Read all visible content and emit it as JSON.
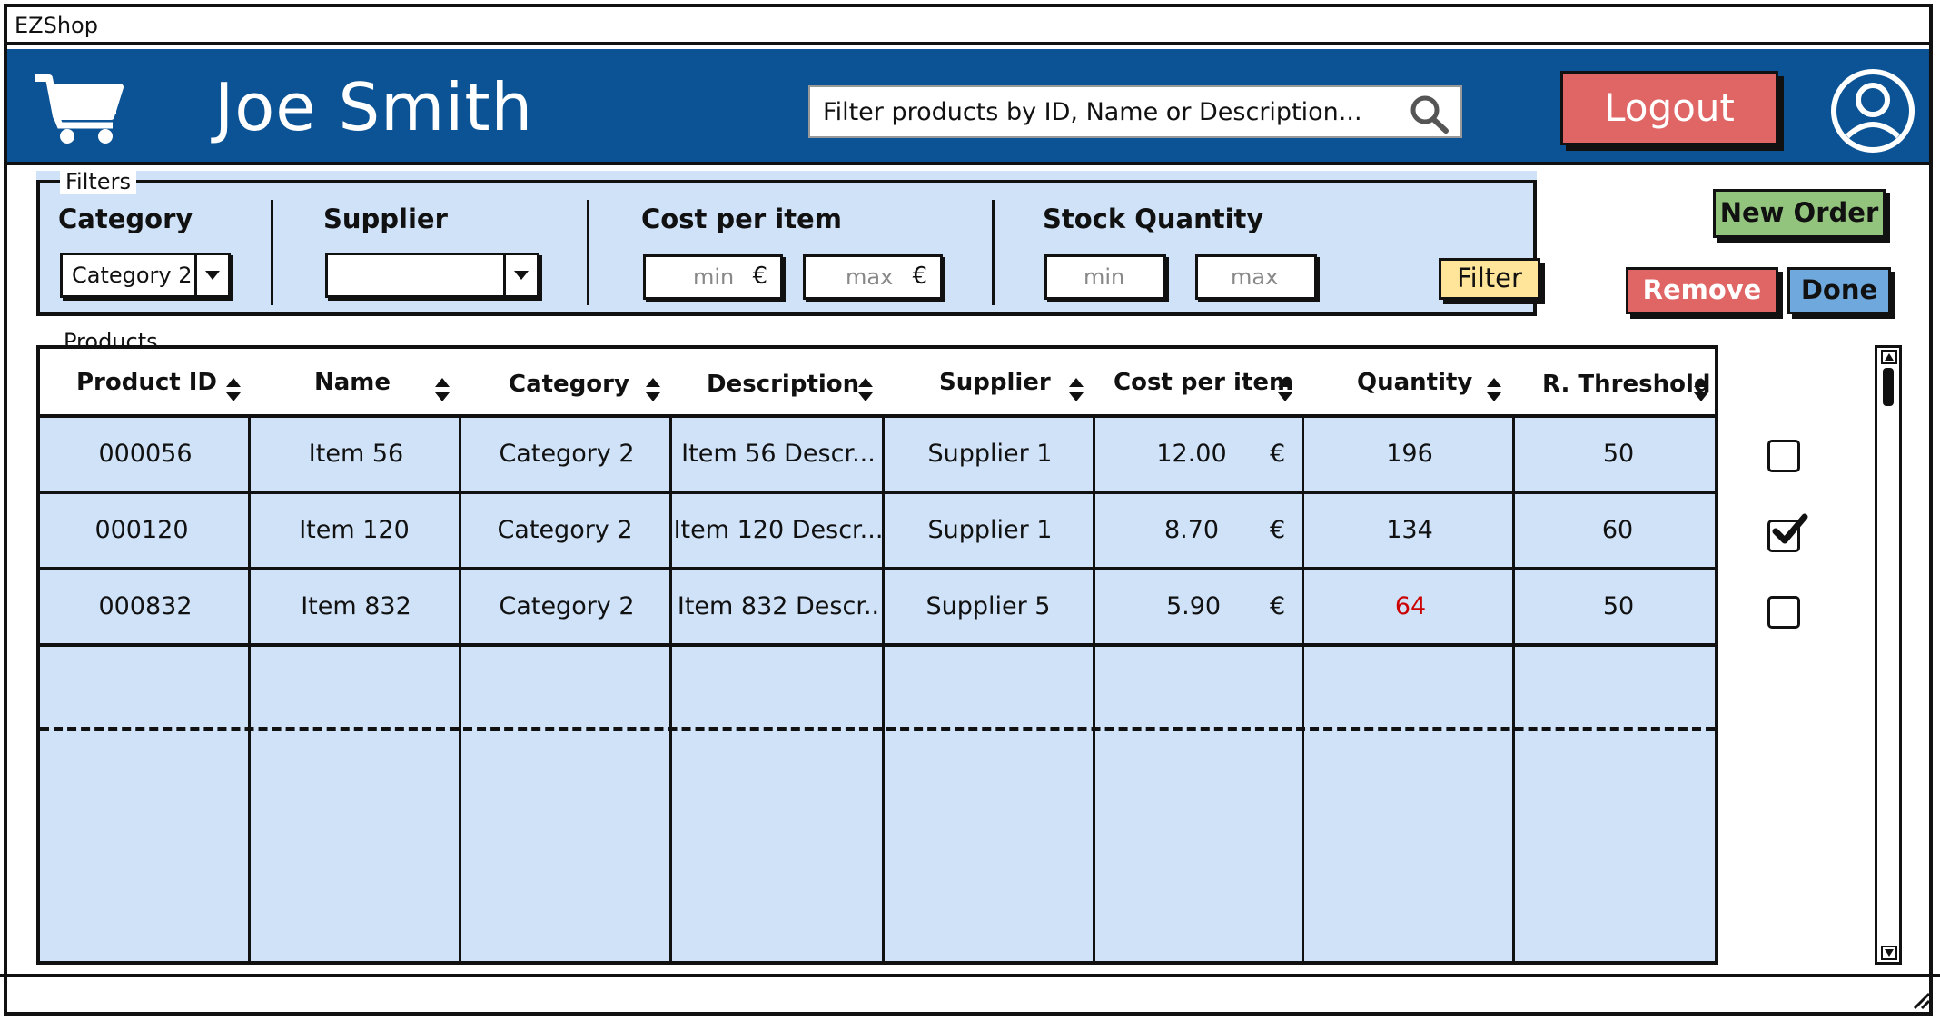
{
  "window": {
    "title": "EZShop"
  },
  "header": {
    "user_name": "Joe Smith",
    "search_placeholder": "Filter products by ID, Name or Description...",
    "logout_label": "Logout",
    "colors": {
      "header_bg": "#0b5394",
      "logout_bg": "#e06666"
    }
  },
  "filters": {
    "legend": "Filters",
    "category_label": "Category",
    "category_value": "Category 2",
    "supplier_label": "Supplier",
    "supplier_value": "",
    "cost_label": "Cost per item",
    "cost_min_placeholder": "min",
    "cost_max_placeholder": "max",
    "currency": "€",
    "stock_label": "Stock Quantity",
    "stock_min_placeholder": "min",
    "stock_max_placeholder": "max",
    "filter_button": "Filter"
  },
  "actions": {
    "new_order": "New Order",
    "remove": "Remove",
    "done": "Done"
  },
  "products": {
    "legend": "Products",
    "columns": [
      "Product ID",
      "Name",
      "Category",
      "Description",
      "Supplier",
      "Cost per item",
      "Quantity",
      "R. Threshold"
    ],
    "rows": [
      {
        "id": "000056",
        "name": "Item 56",
        "category": "Category 2",
        "description": "Item 56 Descr...",
        "supplier": "Supplier 1",
        "cost": "12.00",
        "currency": "€",
        "quantity": "196",
        "threshold": "50",
        "low_stock": false,
        "checked": false
      },
      {
        "id": "000120",
        "name": "Item 120",
        "category": "Category 2",
        "description": "Item 120 Descr...",
        "supplier": "Supplier 1",
        "cost": "8.70",
        "currency": "€",
        "quantity": "134",
        "threshold": "60",
        "low_stock": false,
        "checked": true
      },
      {
        "id": "000832",
        "name": "Item 832",
        "category": "Category 2",
        "description": "Item 832 Descr..",
        "supplier": "Supplier 5",
        "cost": "5.90",
        "currency": "€",
        "quantity": "64",
        "threshold": "50",
        "low_stock": true,
        "checked": false
      }
    ],
    "colors": {
      "table_bg": "#cfe2f8",
      "low_stock_text": "#cc0000"
    }
  }
}
